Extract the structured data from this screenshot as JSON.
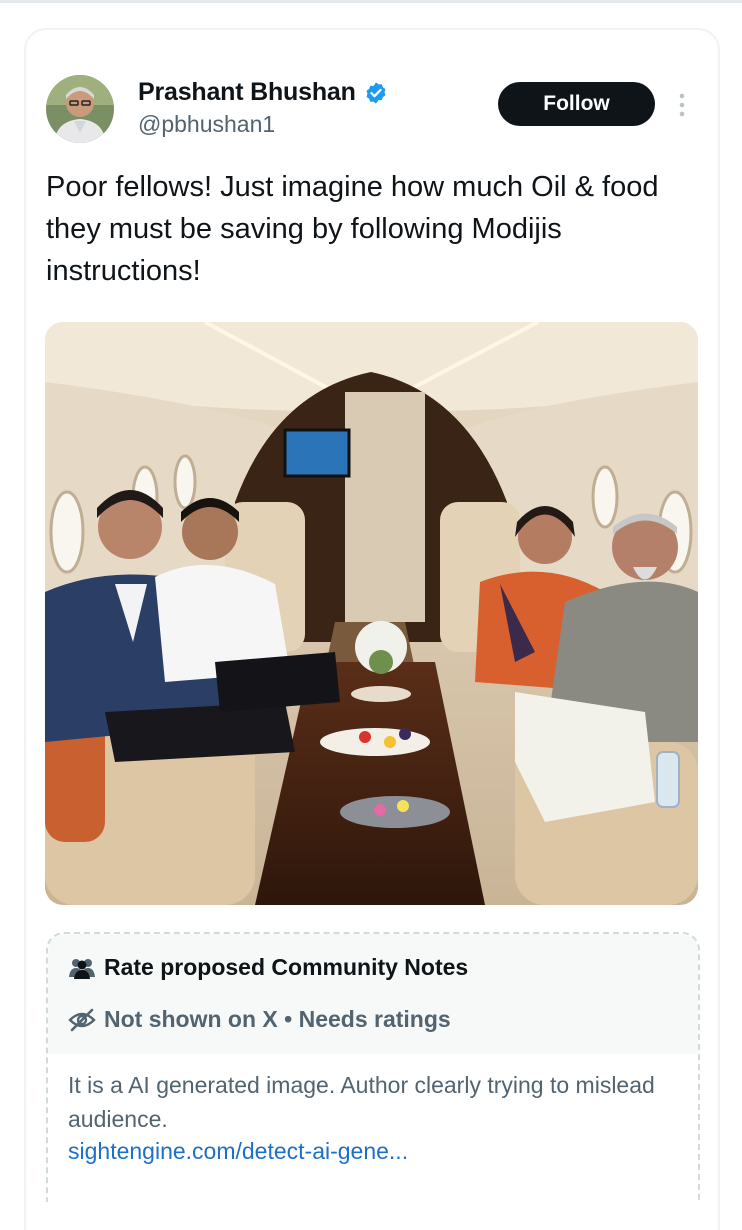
{
  "author": {
    "name": "Prashant Bhushan",
    "handle": "@pbhushan1",
    "verified_icon": "verified-badge-icon"
  },
  "actions": {
    "follow_label": "Follow",
    "more_icon": "more-vertical-icon"
  },
  "tweet": {
    "text": "Poor fellows! Just imagine how much Oil & food they must be saving by following Modijis instructions!"
  },
  "community_note": {
    "header_label": "Rate proposed Community Notes",
    "header_icon": "people-icon",
    "status_label": "Not shown on X • Needs ratings",
    "status_icon": "eye-off-icon",
    "body": "It is a AI generated image. Author clearly trying to mislead audience.",
    "link": "sightengine.com/detect-ai-gene..."
  },
  "colors": {
    "text_primary": "#0f1419",
    "text_secondary": "#536471",
    "verified_blue": "#1d9bf0",
    "link_blue": "#1d6fc9",
    "follow_bg": "#0f1419"
  }
}
